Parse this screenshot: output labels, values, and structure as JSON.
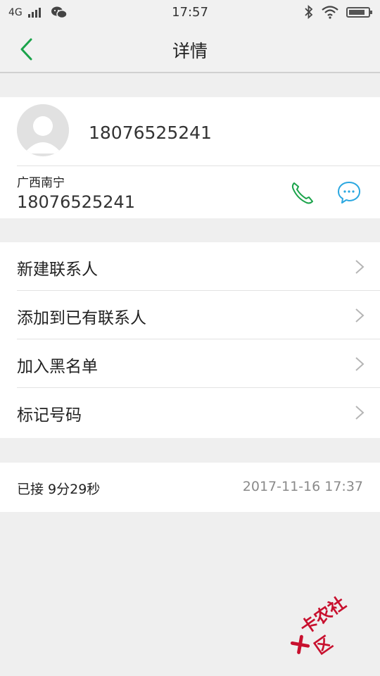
{
  "status_bar": {
    "network": "4G",
    "time": "17:57",
    "battery_level": 0.85
  },
  "header": {
    "title": "详情"
  },
  "contact": {
    "main_number": "18076525241",
    "location": "广西南宁",
    "number": "18076525241"
  },
  "menu": {
    "items": [
      {
        "label": "新建联系人"
      },
      {
        "label": "添加到已有联系人"
      },
      {
        "label": "加入黑名单"
      },
      {
        "label": "标记号码"
      }
    ]
  },
  "call_log": {
    "status": "已接  9分29秒",
    "datetime": "2017-11-16  17:37"
  },
  "watermark": {
    "text": "卡农社区"
  },
  "colors": {
    "accent_green": "#1aa34a",
    "message_blue": "#2aa7e0",
    "watermark_red": "#c8102e"
  },
  "icons": [
    "back-icon",
    "wechat-icon",
    "bluetooth-icon",
    "wifi-icon",
    "battery-icon",
    "phone-call-icon",
    "message-icon",
    "chevron-right-icon"
  ]
}
